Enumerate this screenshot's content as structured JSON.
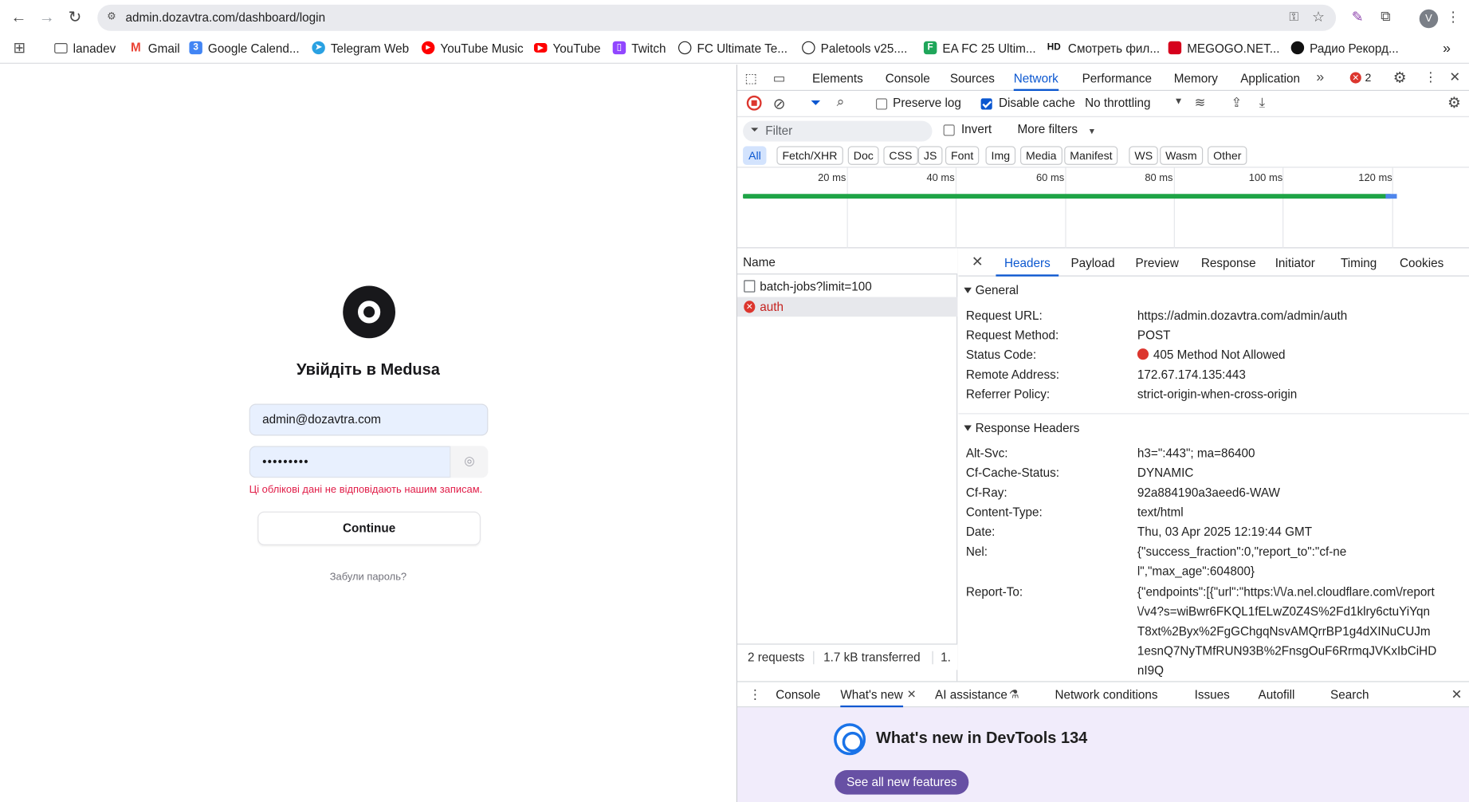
{
  "browser": {
    "url": "admin.dozavtra.com/dashboard/login",
    "profile_initial": "V",
    "bookmarks": [
      {
        "label": "lanadev"
      },
      {
        "label": "Gmail"
      },
      {
        "label": "Google Calend..."
      },
      {
        "label": "Telegram Web"
      },
      {
        "label": "YouTube Music"
      },
      {
        "label": "YouTube"
      },
      {
        "label": "Twitch"
      },
      {
        "label": "FC Ultimate Te..."
      },
      {
        "label": "Paletools v25...."
      },
      {
        "label": "EA FC 25 Ultim..."
      },
      {
        "label": "Смотреть фил..."
      },
      {
        "label": "MEGOGO.NET..."
      },
      {
        "label": "Радио Рекорд..."
      }
    ],
    "bookmark_colors": {
      "gmail": "#ea4335",
      "calendar": "#4285f4",
      "telegram": "#2aa1e2",
      "ytmusic": "#ff0000",
      "youtube": "#ff0000",
      "twitch": "#9146ff"
    }
  },
  "login": {
    "title": "Увійдіть в Medusa",
    "email_value": "admin@dozavtra.com",
    "password_value": "•••••••••",
    "error": "Ці облікові дані не відповідають нашим записам.",
    "continue_label": "Continue",
    "forgot_label": "Забули пароль?"
  },
  "devtools": {
    "tabs": [
      "Elements",
      "Console",
      "Sources",
      "Network",
      "Performance",
      "Memory",
      "Application"
    ],
    "active_tab": "Network",
    "error_count": "2",
    "toolbar": {
      "preserve_log": "Preserve log",
      "disable_cache": "Disable cache",
      "throttling": "No throttling"
    },
    "filter_placeholder": "Filter",
    "invert_label": "Invert",
    "more_filters": "More filters",
    "type_filters": [
      "All",
      "Fetch/XHR",
      "Doc",
      "CSS",
      "JS",
      "Font",
      "Img",
      "Media",
      "Manifest",
      "WS",
      "Wasm",
      "Other"
    ],
    "timeline_ticks": [
      "20 ms",
      "40 ms",
      "60 ms",
      "80 ms",
      "100 ms",
      "120 ms"
    ],
    "name_header": "Name",
    "requests": [
      {
        "name": "batch-jobs?limit=100",
        "status": "ok"
      },
      {
        "name": "auth",
        "status": "error"
      }
    ],
    "detail_tabs": [
      "Headers",
      "Payload",
      "Preview",
      "Response",
      "Initiator",
      "Timing",
      "Cookies"
    ],
    "general_label": "General",
    "general": [
      {
        "key": "Request URL:",
        "value": "https://admin.dozavtra.com/admin/auth"
      },
      {
        "key": "Request Method:",
        "value": "POST"
      },
      {
        "key": "Status Code:",
        "value": "405 Method Not Allowed"
      },
      {
        "key": "Remote Address:",
        "value": "172.67.174.135:443"
      },
      {
        "key": "Referrer Policy:",
        "value": "strict-origin-when-cross-origin"
      }
    ],
    "response_headers_label": "Response Headers",
    "response_headers": [
      {
        "key": "Alt-Svc:",
        "value": "h3=\":443\"; ma=86400"
      },
      {
        "key": "Cf-Cache-Status:",
        "value": "DYNAMIC"
      },
      {
        "key": "Cf-Ray:",
        "value": "92a884190a3aeed6-WAW"
      },
      {
        "key": "Content-Type:",
        "value": "text/html"
      },
      {
        "key": "Date:",
        "value": "Thu, 03 Apr 2025 12:19:44 GMT"
      },
      {
        "key": "Nel:",
        "value": "{\"success_fraction\":0,\"report_to\":\"cf-nel\",\"max_age\":604800}"
      },
      {
        "key": "Report-To:",
        "value": "{\"endpoints\":[{\"url\":\"https:\\/\\/a.nel.cloudflare.com\\/report\\/v4?s=wiBwr6FKQL1fELwZ0Z4S%2Fd1klry6ctuYiYqnT8xt%2Byx%2FgGChgqNsvAMQrrBP1g4dXINuCUJm1esnQ7NyTMfRUN93B%2FnsgOuF6RrmqJVKxIbCiHDnI9Q"
      }
    ],
    "status": {
      "requests": "2 requests",
      "transferred": "1.7 kB transferred",
      "more": "1."
    },
    "drawer_tabs": [
      "Console",
      "What's new",
      "AI assistance",
      "Network conditions",
      "Issues",
      "Autofill",
      "Search"
    ],
    "whats_new_title": "What's new in DevTools 134",
    "whats_new_button": "See all new features"
  },
  "colors": {
    "accent": "#0b57d0",
    "error": "#dc362e",
    "medusa_dark": "#18181b",
    "wn_button": "#6750a4"
  }
}
